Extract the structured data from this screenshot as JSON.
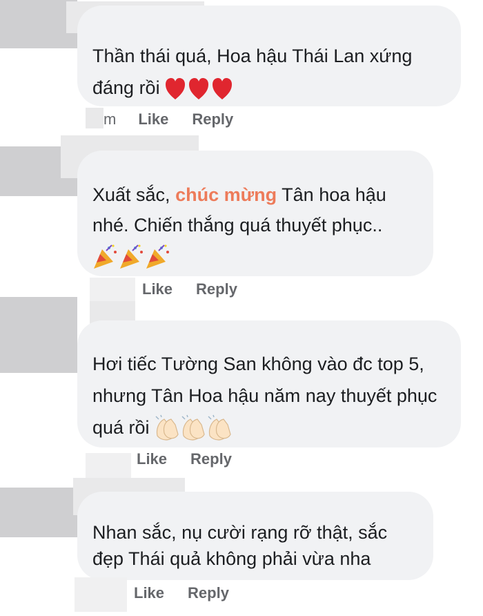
{
  "comments": [
    {
      "text": "Thần thái quá, Hoa hậu Thái Lan xứng đáng rồi",
      "emojis": [
        "red-heart",
        "red-heart",
        "red-heart"
      ],
      "time": "m",
      "like_label": "Like",
      "reply_label": "Reply"
    },
    {
      "text_before": "Xuất sắc, ",
      "highlight": "chúc mừng",
      "text_after": " Tân hoa hậu nhé. Chiến thắng quá thuyết phục..",
      "emojis": [
        "party-popper",
        "party-popper",
        "party-popper"
      ],
      "like_label": "Like",
      "reply_label": "Reply",
      "highlight_color": "#ed7b5a"
    },
    {
      "text": "Hơi tiếc Tường San không vào đc top 5, nhưng Tân Hoa hậu năm nay thuyết phục quá rồi",
      "emojis": [
        "clapping-hands",
        "clapping-hands",
        "clapping-hands"
      ],
      "like_label": "Like",
      "reply_label": "Reply"
    },
    {
      "text": "Nhan sắc, nụ cười rạng rỡ thật, sắc đẹp Thái quả không phải vừa nha",
      "like_label": "Like",
      "reply_label": "Reply"
    }
  ],
  "colors": {
    "bubble": "#f1f2f4",
    "action_text": "#65676b",
    "highlight": "#ed7b5a"
  }
}
